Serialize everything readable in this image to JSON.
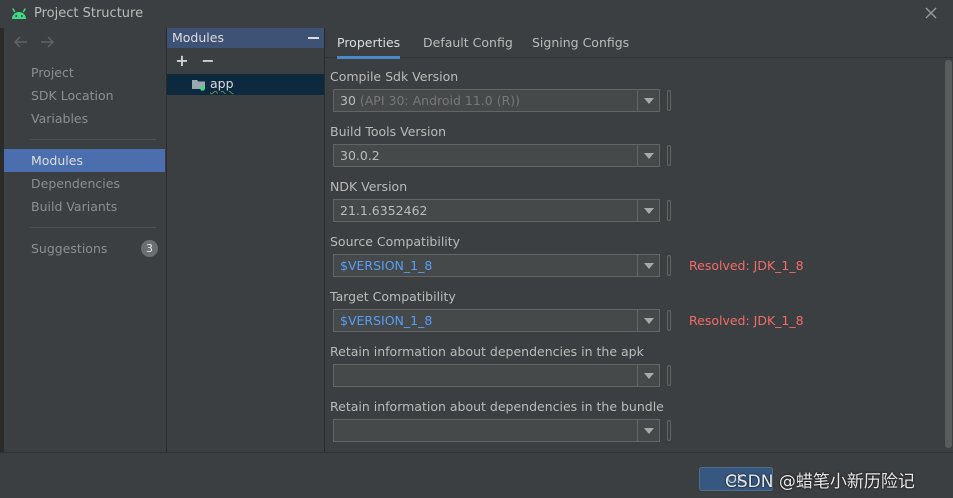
{
  "window": {
    "title": "Project Structure"
  },
  "nav": {
    "items": [
      {
        "label": "Project",
        "selected": false
      },
      {
        "label": "SDK Location",
        "selected": false
      },
      {
        "label": "Variables",
        "selected": false
      },
      {
        "label": "Modules",
        "selected": true
      },
      {
        "label": "Dependencies",
        "selected": false
      },
      {
        "label": "Build Variants",
        "selected": false
      },
      {
        "label": "Suggestions",
        "selected": false,
        "badge": "3"
      }
    ]
  },
  "modules": {
    "header": "Modules",
    "add_symbol": "+",
    "remove_symbol": "−",
    "items": [
      {
        "label": "app"
      }
    ]
  },
  "tabs": [
    {
      "label": "Properties",
      "active": true
    },
    {
      "label": "Default Config",
      "active": false
    },
    {
      "label": "Signing Configs",
      "active": false
    }
  ],
  "properties": {
    "compile_sdk": {
      "label": "Compile Sdk Version",
      "value": "30",
      "hint": " (API 30: Android 11.0 (R))"
    },
    "build_tools": {
      "label": "Build Tools Version",
      "value": "30.0.2"
    },
    "ndk": {
      "label": "NDK Version",
      "value": "21.1.6352462"
    },
    "source_compat": {
      "label": "Source Compatibility",
      "value": "$VERSION_1_8",
      "resolved": "Resolved: JDK_1_8"
    },
    "target_compat": {
      "label": "Target Compatibility",
      "value": "$VERSION_1_8",
      "resolved": "Resolved: JDK_1_8"
    },
    "retain_apk": {
      "label": "Retain information about dependencies in the apk",
      "value": ""
    },
    "retain_bundle": {
      "label": "Retain information about dependencies in the bundle",
      "value": ""
    }
  },
  "footer": {
    "ok_label": "OK",
    "watermark": "CSDN @蜡笔小新历险记"
  },
  "colors": {
    "background": "#3c3f41",
    "selection": "#4b6eaf",
    "module_header": "#3d5275",
    "tab_underline": "#4a88c7",
    "reference_text": "#589df6",
    "resolved_text": "#f26b6b",
    "android_green": "#3ddc84"
  },
  "icons": {
    "title": "android-icon",
    "close": "close-icon",
    "back": "back-arrow-icon",
    "forward": "forward-arrow-icon",
    "module": "module-folder-icon"
  }
}
